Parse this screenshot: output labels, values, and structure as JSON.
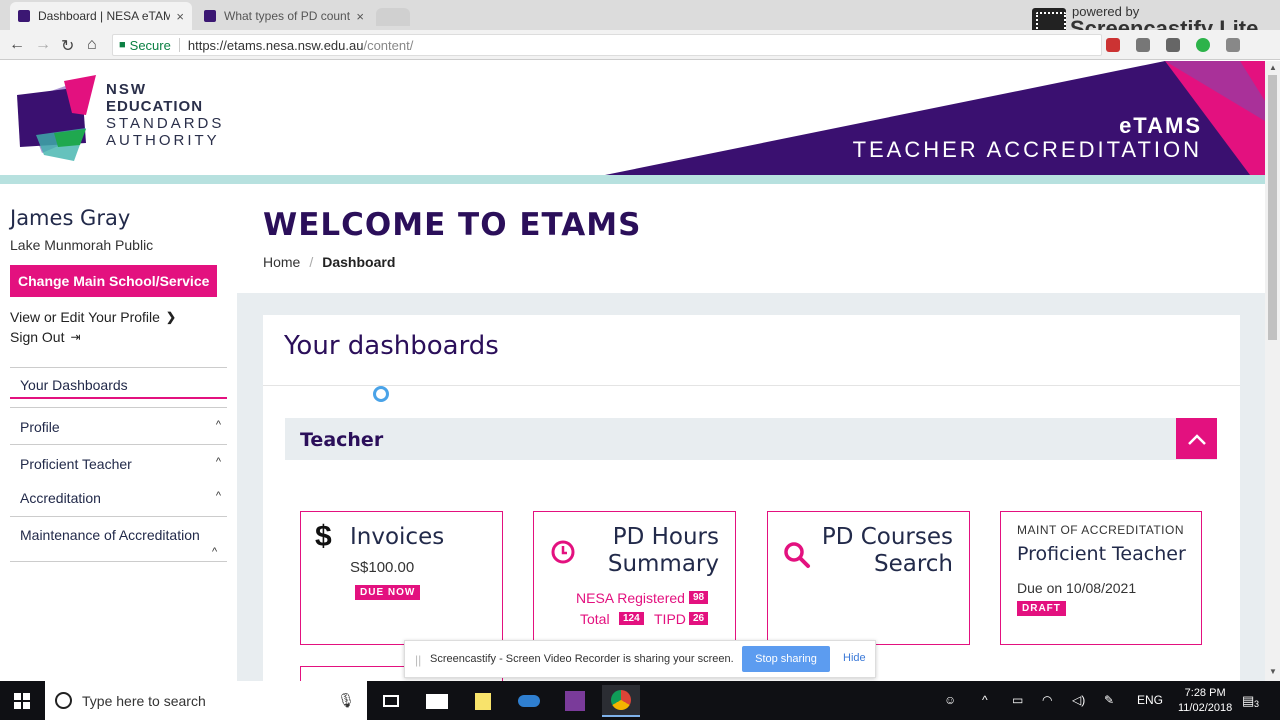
{
  "browser": {
    "tabs": [
      {
        "title": "Dashboard | NESA eTAMS",
        "close": "×"
      },
      {
        "title": "What types of PD count | NESA",
        "close": "×"
      }
    ],
    "address": {
      "secure_label": "Secure",
      "host": "https://etams.nesa.nsw.edu.au",
      "path": "/content/"
    }
  },
  "watermark": {
    "powered_by": "powered by",
    "brand": "Screencastify Lite"
  },
  "header": {
    "logo_lines": [
      "NSW",
      "EDUCATION",
      "STANDARDS",
      "AUTHORITY"
    ],
    "app_title": "eTAMS",
    "app_subtitle": "TEACHER ACCREDITATION",
    "colors": {
      "purple": "#3a1070",
      "pink": "#e3117f",
      "teal": "#b7e1df",
      "green": "#1fa84f"
    }
  },
  "sidebar": {
    "user_name": "James Gray",
    "school": "Lake Munmorah Public",
    "change_button": "Change Main School/Service",
    "view_profile": "View or Edit Your Profile",
    "sign_out": "Sign Out",
    "menu": [
      {
        "label": "Your Dashboards"
      },
      {
        "label": "Profile"
      },
      {
        "label": "Proficient Teacher"
      },
      {
        "label": "Accreditation"
      },
      {
        "label": "Maintenance of Accreditation"
      }
    ]
  },
  "main": {
    "welcome": "WELCOME TO ETAMS",
    "breadcrumb": {
      "home": "Home",
      "separator": "/",
      "current": "Dashboard"
    },
    "panel_title": "Your dashboards",
    "section_title": "Teacher",
    "cards": {
      "invoices": {
        "icon": "$",
        "title": "Invoices",
        "amount": "S$100.00",
        "badge": "DUE NOW"
      },
      "pd_hours": {
        "title_line1": "PD Hours",
        "title_line2": "Summary",
        "nesa_label": "NESA Registered",
        "nesa_value": "98",
        "total_label": "Total",
        "total_value": "124",
        "tipd_label": "TIPD",
        "tipd_value": "26"
      },
      "pd_courses": {
        "title_line1": "PD Courses",
        "title_line2": "Search"
      },
      "maint": {
        "kicker": "MAINT OF ACCREDITATION",
        "title": "Proficient Teacher",
        "due": "Due on 10/08/2021",
        "badge": "DRAFT"
      }
    }
  },
  "share_bar": {
    "grip": "||",
    "message": "Screencastify - Screen Video Recorder is sharing your screen.",
    "stop": "Stop sharing",
    "hide": "Hide"
  },
  "taskbar": {
    "search_placeholder": "Type here to search",
    "lang": "ENG",
    "time": "7:28 PM",
    "date": "11/02/2018",
    "notif_count": "3"
  }
}
